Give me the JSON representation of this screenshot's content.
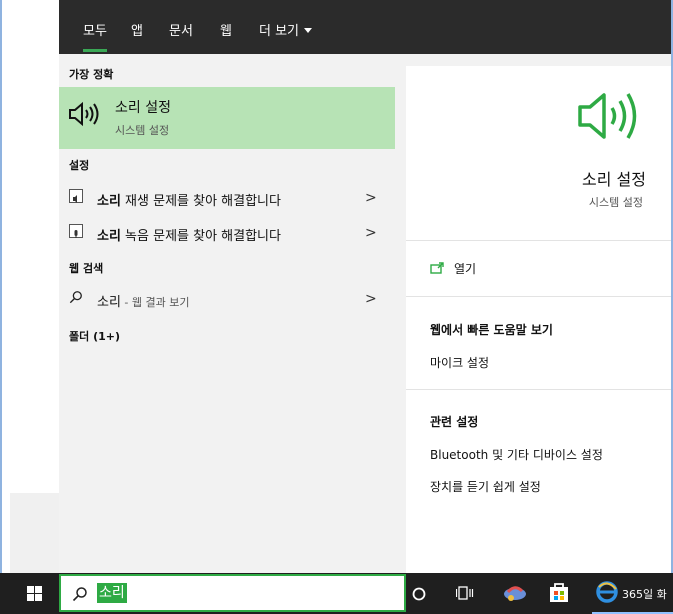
{
  "tabs": [
    {
      "label": "모두",
      "active": true
    },
    {
      "label": "앱"
    },
    {
      "label": "문서"
    },
    {
      "label": "웹"
    },
    {
      "label": "더 보기"
    }
  ],
  "left": {
    "best_match_header": "가장 정확",
    "best_match": {
      "title": "소리 설정",
      "subtitle": "시스템 설정",
      "icon": "speaker-icon"
    },
    "settings_header": "설정",
    "settings_items": [
      {
        "bold": "소리",
        "rest": " 재생 문제를 찾아 해결합니다",
        "icon": "troubleshoot-icon"
      },
      {
        "bold": "소리",
        "rest": " 녹음 문제를 찾아 해결합니다",
        "icon": "troubleshoot-icon"
      }
    ],
    "web_header": "웹 검색",
    "web_item": {
      "term": "소리",
      "suffix": " - 웹 결과 보기",
      "icon": "search-icon"
    },
    "folders_header": "폴더 (1+)"
  },
  "right": {
    "title": "소리 설정",
    "subtitle": "시스템 설정",
    "open_label": "열기",
    "help_header": "웹에서 빠른 도움말 보기",
    "help_links": [
      "마이크 설정"
    ],
    "related_header": "관련 설정",
    "related_links": [
      "Bluetooth 및 기타 디바이스 설정",
      "장치를 듣기 쉽게 설정"
    ]
  },
  "taskbar": {
    "search_query": "소리",
    "app_label": "365일 화",
    "icons": [
      "windows-start-icon",
      "cortana-circle-icon",
      "task-view-icon",
      "app-icon",
      "store-icon",
      "edge-browser-icon"
    ]
  },
  "colors": {
    "accent": "#2eaa44",
    "highlight": "#b7e3b5",
    "tabbar": "#2b2b2b",
    "taskbar": "#1f1f1f"
  }
}
